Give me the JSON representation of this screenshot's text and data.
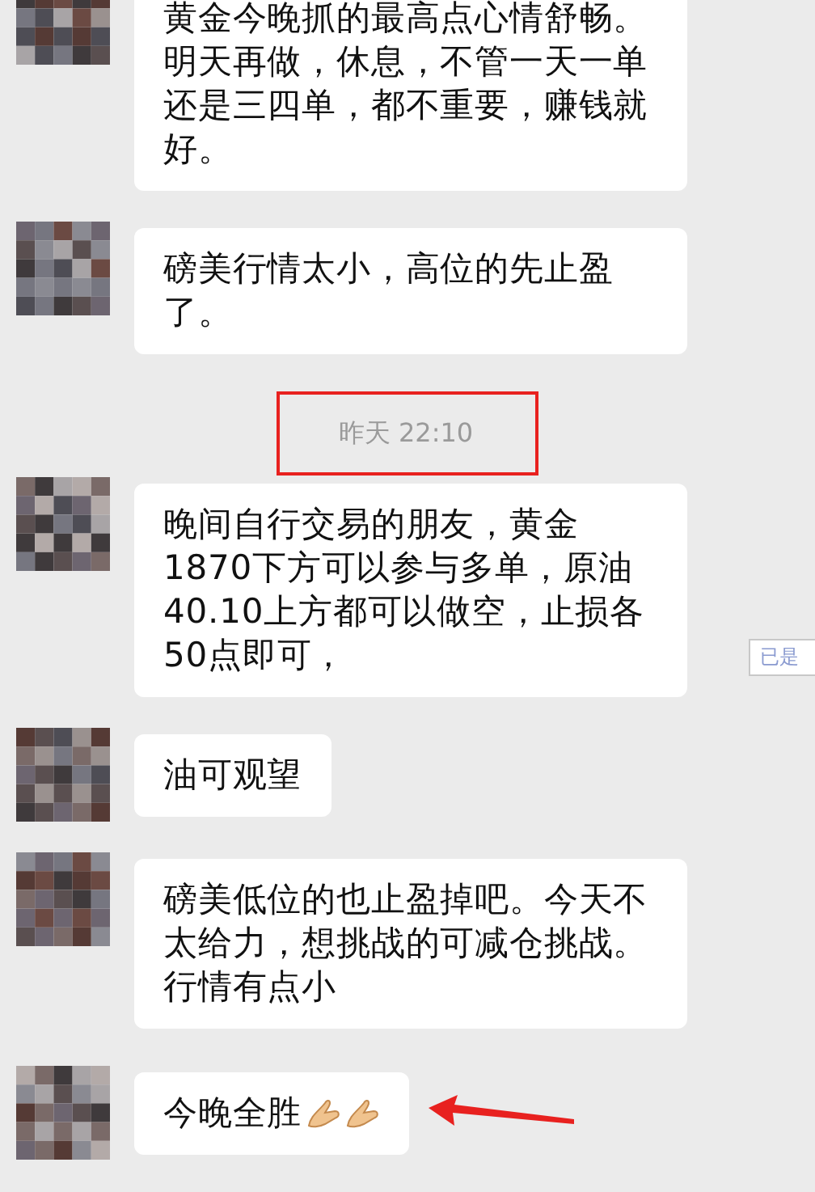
{
  "messages": [
    {
      "kind": "text",
      "text": "黄金今晚抓的最高点心情舒畅。明天再做，休息，不管一天一单还是三四单，都不重要，赚钱就好。"
    },
    {
      "kind": "text",
      "text": "磅美行情太小，高位的先止盈了。"
    },
    {
      "kind": "time",
      "text": "昨天 22:10",
      "highlighted": true
    },
    {
      "kind": "text",
      "text": "晚间自行交易的朋友，黄金1870下方可以参与多单，原油40.10上方都可以做空，止损各50点即可，"
    },
    {
      "kind": "text",
      "text": "油可观望"
    },
    {
      "kind": "text",
      "text": "磅美低位的也止盈掉吧。今天不太给力，想挑战的可减仓挑战。行情有点小"
    },
    {
      "kind": "emoji",
      "text": "今晚全胜",
      "marked": true
    }
  ],
  "tooltip": {
    "text": "已是"
  }
}
